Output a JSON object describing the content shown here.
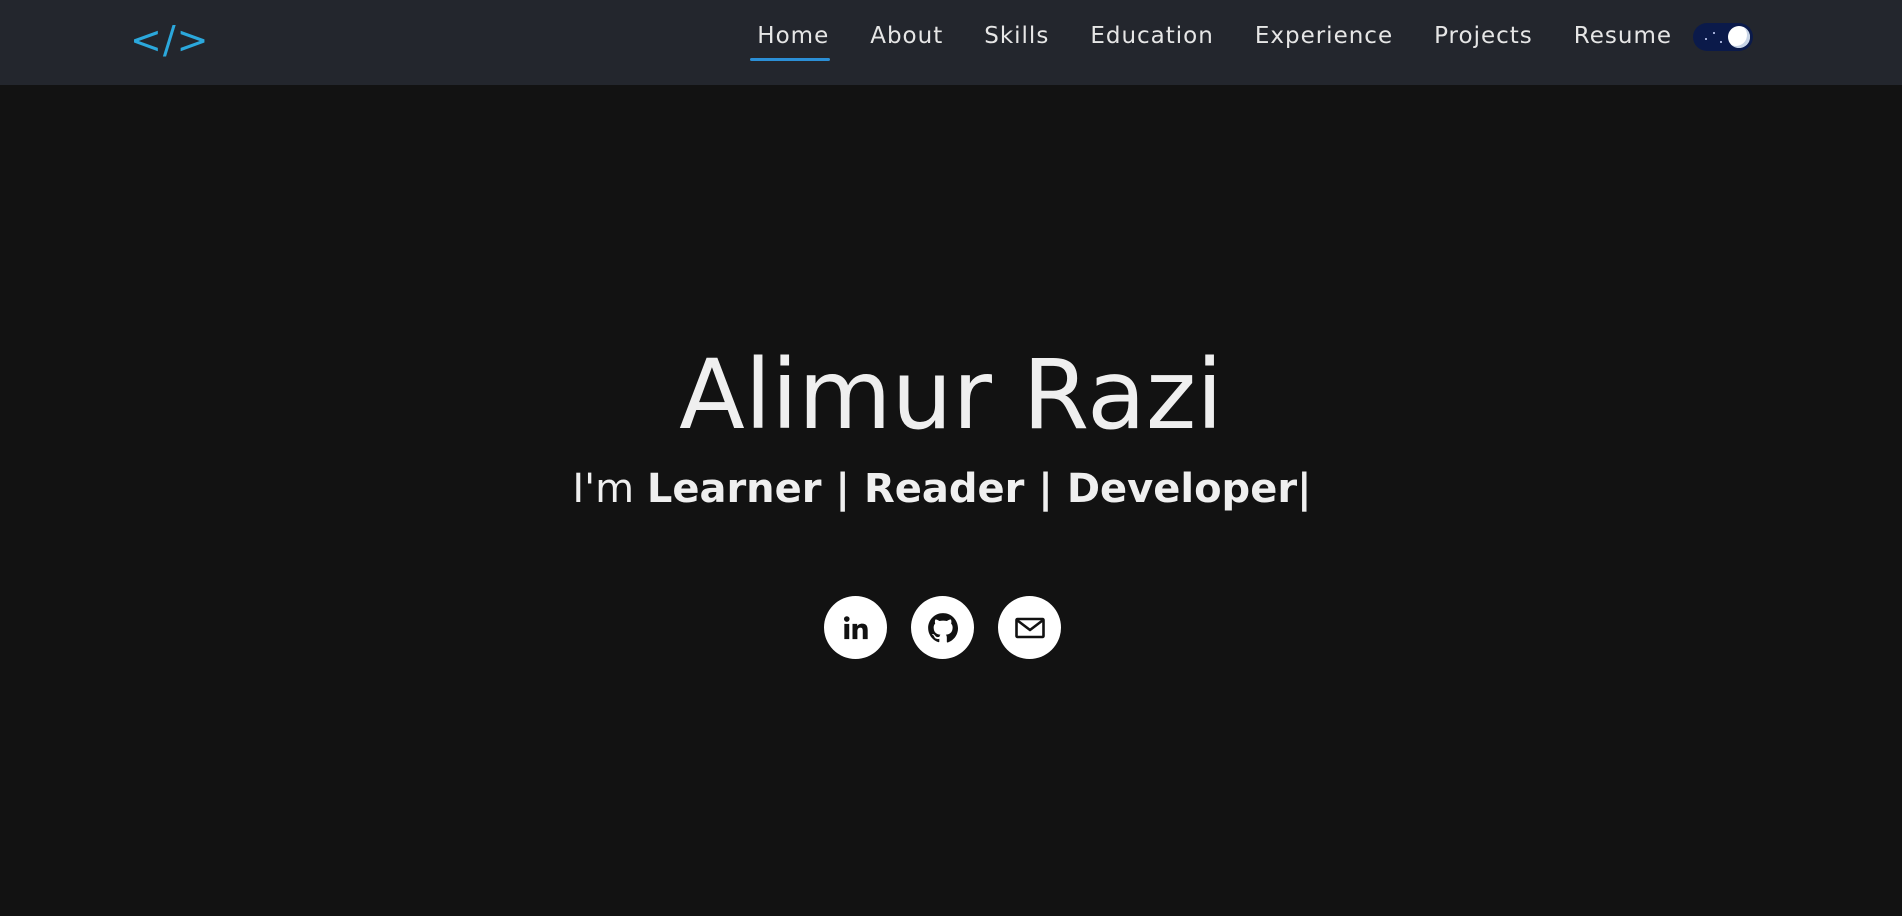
{
  "logo": {
    "text": "</>",
    "color": "#2ba8dc"
  },
  "nav": {
    "items": [
      {
        "label": "Home",
        "active": true
      },
      {
        "label": "About"
      },
      {
        "label": "Skills"
      },
      {
        "label": "Education"
      },
      {
        "label": "Experience"
      },
      {
        "label": "Projects"
      },
      {
        "label": "Resume"
      }
    ],
    "theme_toggle": {
      "state": "dark",
      "icon": "moon-icon"
    }
  },
  "hero": {
    "name": "Alimur Razi",
    "tag_prefix": "I'm ",
    "roles": "Learner | Reader | Developer|"
  },
  "socials": [
    {
      "name": "linkedin",
      "icon": "linkedin-icon"
    },
    {
      "name": "github",
      "icon": "github-icon"
    },
    {
      "name": "email",
      "icon": "mail-icon"
    }
  ],
  "colors": {
    "background": "#121212",
    "navbar": "#23262d",
    "accent": "#2b8fd6",
    "text": "#efefef"
  }
}
